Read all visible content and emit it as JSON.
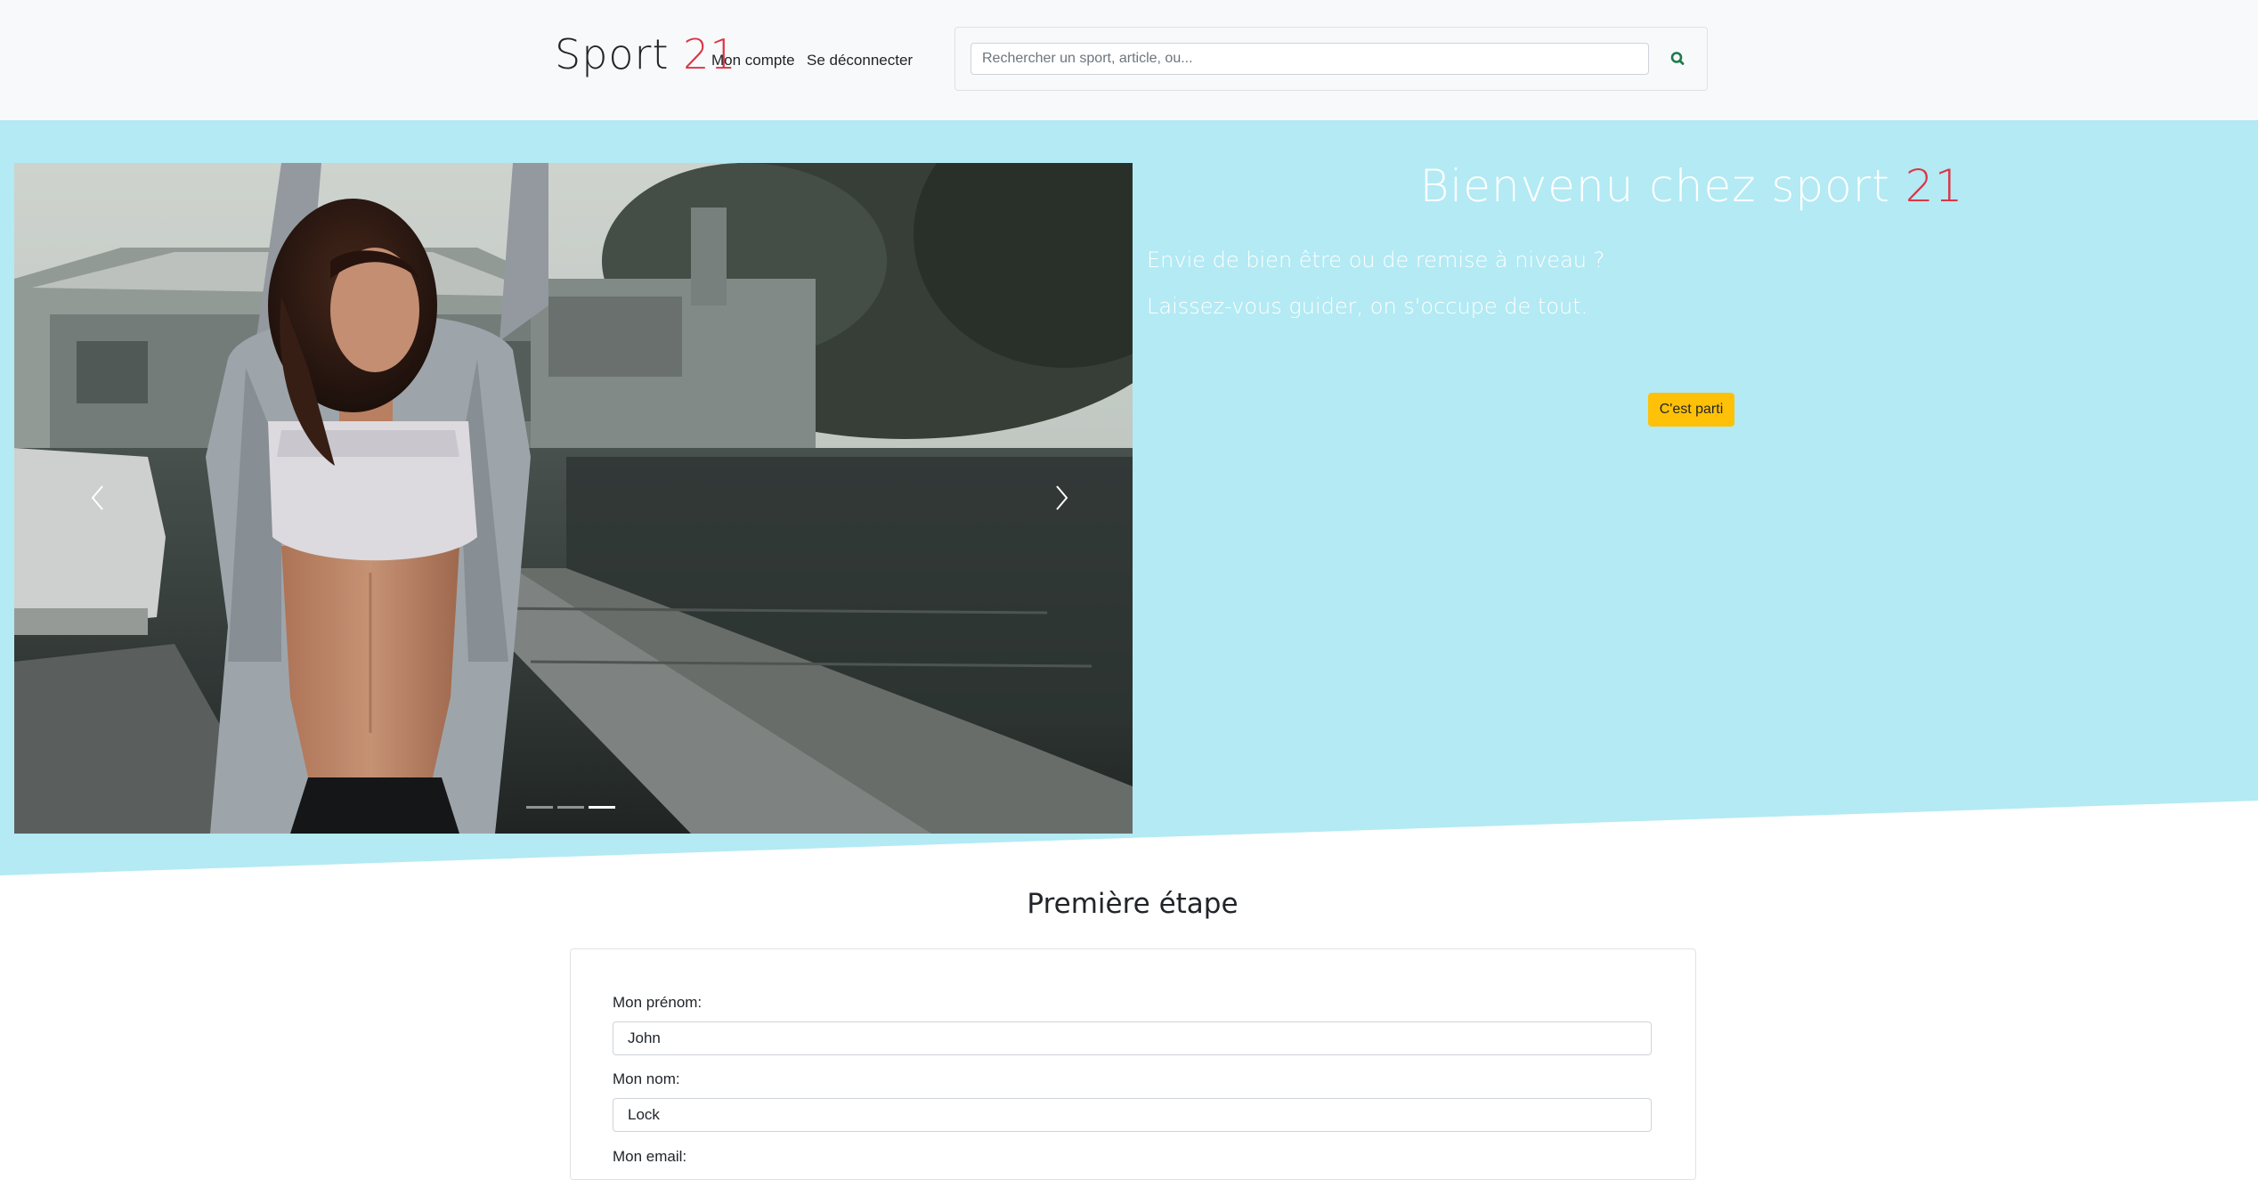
{
  "navbar": {
    "brand_text": "Sport",
    "brand_number": "21",
    "account_link": "Mon compte",
    "logout_link": "Se déconnecter",
    "search": {
      "placeholder": "Rechercher un sport, article, ou...",
      "value": "",
      "button_icon": "search-icon"
    }
  },
  "hero": {
    "title_text": "Bienvenu chez sport",
    "title_number": "21",
    "line1": "Envie de bien être ou de remise à niveau ?",
    "line2": "Laissez-vous guider, on s'occupe de tout.",
    "cta_label": "C'est parti",
    "carousel": {
      "prev_icon": "chevron-left-icon",
      "next_icon": "chevron-right-icon",
      "slide_count": 3,
      "active_slide": 3
    }
  },
  "form": {
    "section_title": "Première étape",
    "firstname_label": "Mon prénom:",
    "firstname_value": "John",
    "lastname_label": "Mon nom:",
    "lastname_value": "Lock",
    "email_label": "Mon email:"
  },
  "colors": {
    "accent_red": "#dc3545",
    "hero_background": "#b3eaf4",
    "cta_yellow": "#ffc107",
    "search_icon_green": "#1e7a4c",
    "navbar_background": "#f8f9fa"
  }
}
